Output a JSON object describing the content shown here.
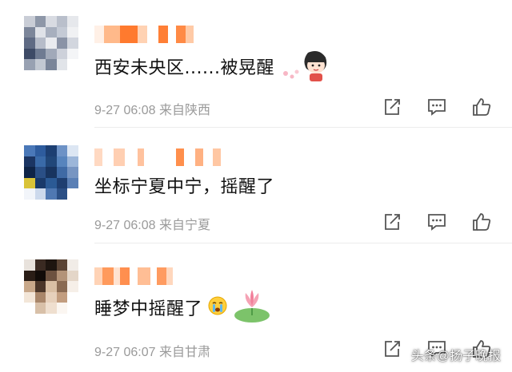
{
  "comments": [
    {
      "text": "西安未央区......被晃醒",
      "meta": "9-27 06:08 来自陕西",
      "sticker": "chibi-maruko-sticker"
    },
    {
      "text": "坐标宁夏中宁，摇醒了",
      "meta": "9-27 06:08 来自宁夏",
      "sticker": ""
    },
    {
      "text": "睡梦中摇醒了",
      "meta": "9-27 06:07 来自甘肃",
      "sticker": "lotus-sticker"
    }
  ],
  "icons": {
    "share": "share-icon",
    "comment": "comment-icon",
    "like": "thumbs-up-icon",
    "crying_emoji": "crying-emoji-icon"
  },
  "watermark": "头条@扬子晚报",
  "colors": {
    "text": "#111111",
    "meta": "#9a9a9a",
    "icon": "#555555",
    "divider": "#ececec"
  }
}
